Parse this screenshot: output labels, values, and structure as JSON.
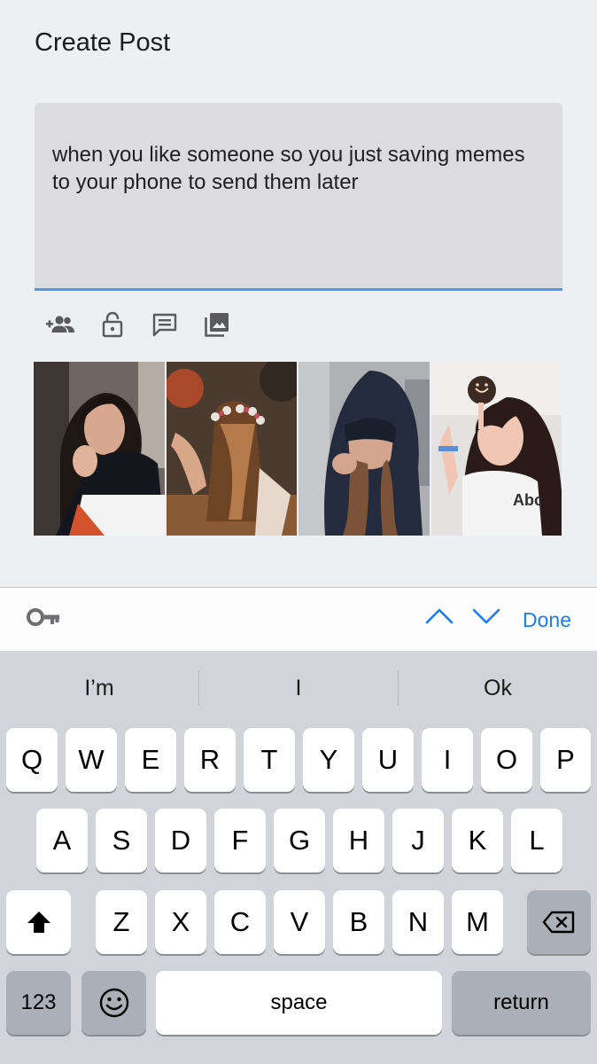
{
  "header": {
    "title": "Create Post"
  },
  "post": {
    "text": "when you like someone so you just saving memes to your phone to send them later",
    "accent_color": "#4a9be6"
  },
  "toolbar": {
    "icons": [
      "add-friends-icon",
      "lock-icon",
      "comment-icon",
      "photos-icon"
    ]
  },
  "gallery": {
    "photos": [
      "photo-1",
      "photo-2",
      "photo-3",
      "photo-4"
    ]
  },
  "accessory": {
    "done_label": "Done",
    "link_color": "#1a7cf2"
  },
  "keyboard": {
    "suggestions": [
      "I’m",
      "I",
      "Ok"
    ],
    "row1": [
      "Q",
      "W",
      "E",
      "R",
      "T",
      "Y",
      "U",
      "I",
      "O",
      "P"
    ],
    "row2": [
      "A",
      "S",
      "D",
      "F",
      "G",
      "H",
      "J",
      "K",
      "L"
    ],
    "row3": [
      "Z",
      "X",
      "C",
      "V",
      "B",
      "N",
      "M"
    ],
    "numbers_label": "123",
    "space_label": "space",
    "return_label": "return"
  }
}
